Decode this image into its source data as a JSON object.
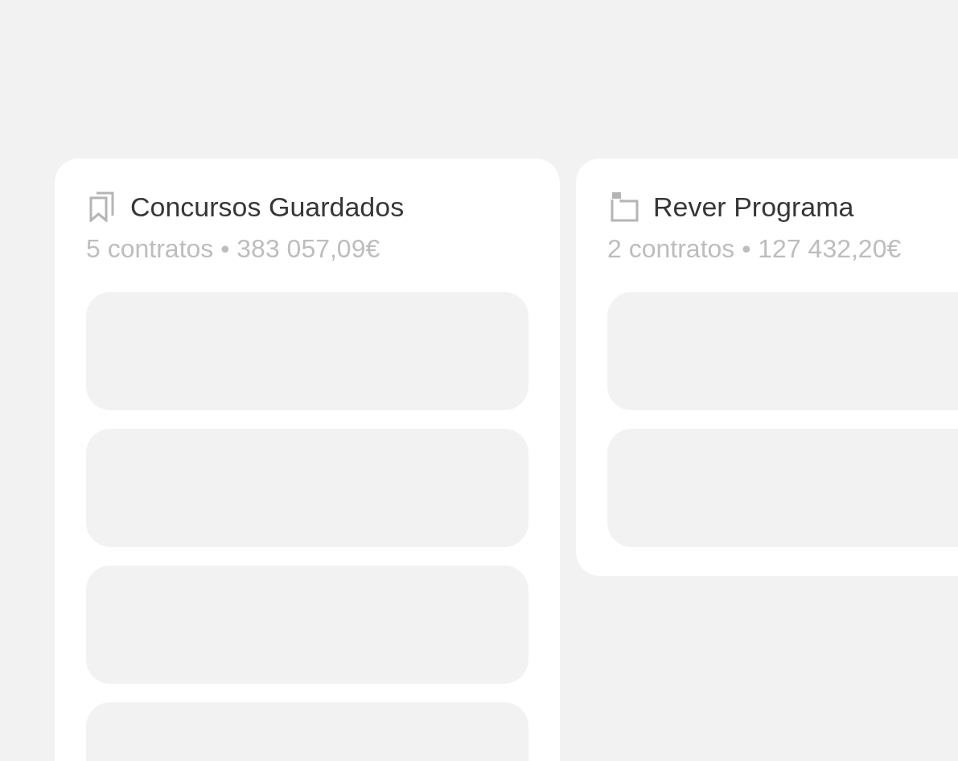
{
  "columns": [
    {
      "title": "Concursos Guardados",
      "summary": "5 contratos • 383 057,09€",
      "items": [
        {
          "kind": "placeholder"
        },
        {
          "kind": "placeholder"
        },
        {
          "kind": "placeholder"
        },
        {
          "kind": "placeholder"
        }
      ]
    },
    {
      "title": "Rever Programa",
      "summary": "2 contratos • 127 432,20€",
      "items": [
        {
          "kind": "placeholder"
        },
        {
          "kind": "placeholder"
        }
      ]
    }
  ]
}
